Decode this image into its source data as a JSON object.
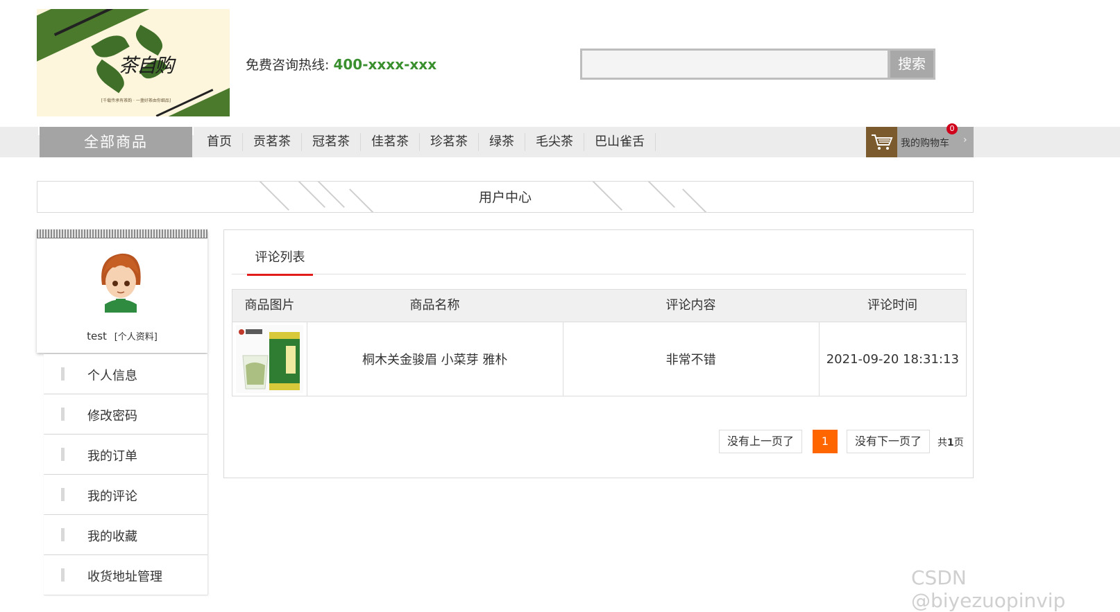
{
  "header": {
    "brand_text": "茶自购",
    "slogan": "[千载传承有茶韵 · 一盏好茶由你细品]",
    "hotline_label": "免费咨询热线:",
    "hotline_number": "400-xxxx-xxx",
    "search_placeholder": "",
    "search_button": "搜索"
  },
  "nav": {
    "all_goods": "全部商品",
    "items": [
      "首页",
      "贡茗茶",
      "冠茗茶",
      "佳茗茶",
      "珍茗茶",
      "绿茶",
      "毛尖茶",
      "巴山雀舌"
    ],
    "cart_label": "我的购物车",
    "cart_count": "0"
  },
  "page_title": "用户中心",
  "profile": {
    "username": "test",
    "profile_link": "[个人资料]"
  },
  "menu": [
    "个人信息",
    "修改密码",
    "我的订单",
    "我的评论",
    "我的收藏",
    "收货地址管理"
  ],
  "tab_label": "评论列表",
  "table": {
    "headers": [
      "商品图片",
      "商品名称",
      "评论内容",
      "评论时间"
    ],
    "rows": [
      {
        "product_name": "桐木关金骏眉 小菜芽 雅朴",
        "comment": "非常不错",
        "time": "2021-09-20 18:31:13"
      }
    ]
  },
  "pagination": {
    "prev": "没有上一页了",
    "current": "1",
    "next": "没有下一页了",
    "total_prefix": "共",
    "total_pages": "1",
    "total_suffix": "页"
  },
  "watermark": "CSDN @biyezuopinvip"
}
